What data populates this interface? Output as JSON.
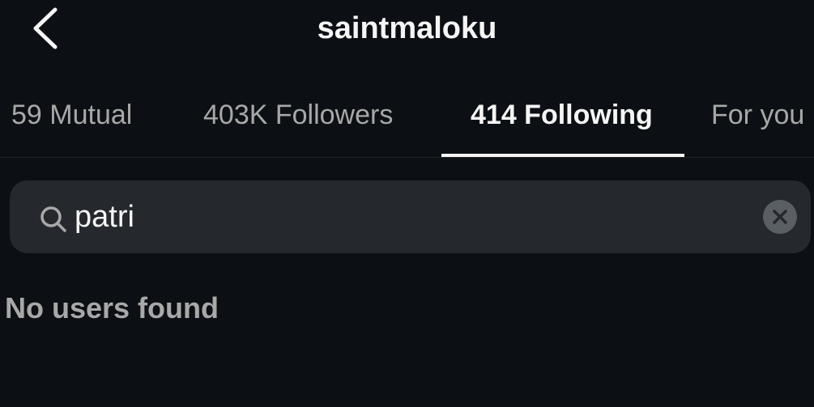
{
  "header": {
    "title": "saintmaloku",
    "back_icon": "chevron-left-icon"
  },
  "tabs": [
    {
      "label": "59 Mutual",
      "active": false
    },
    {
      "label": "403K Followers",
      "active": false
    },
    {
      "label": "414 Following",
      "active": true
    },
    {
      "label": "For you",
      "active": false
    }
  ],
  "search": {
    "value": "patri",
    "icon": "search-icon",
    "clear_icon": "close-icon"
  },
  "results": {
    "empty_message": "No users found"
  },
  "colors": {
    "background": "#0c1014",
    "search_bg": "#25292e",
    "text_primary": "#f5f5f5",
    "text_secondary": "#a8a8a8"
  }
}
